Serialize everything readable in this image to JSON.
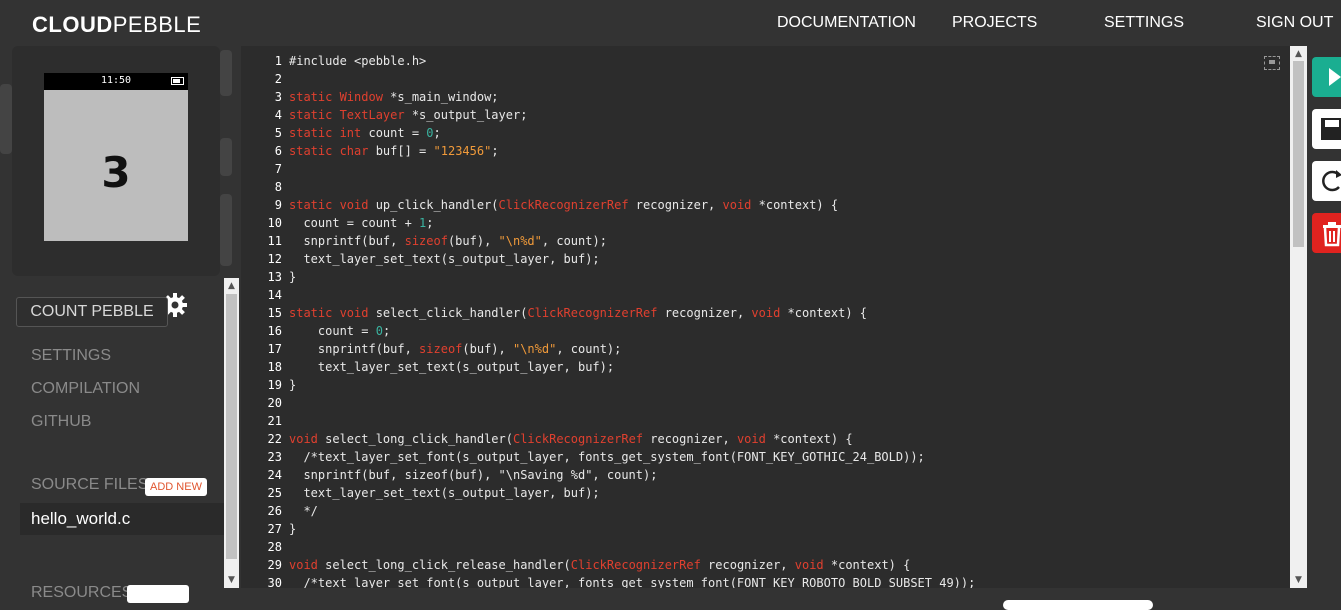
{
  "brand": {
    "bold": "CLOUD",
    "light": "PEBBLE"
  },
  "nav": [
    "DOCUMENTATION",
    "PROJECTS",
    "SETTINGS",
    "SIGN OUT"
  ],
  "emulator": {
    "time": "11:50",
    "count": "3"
  },
  "sidebar": {
    "project_name": "COUNT PEBBLE",
    "links": [
      "SETTINGS",
      "COMPILATION",
      "GITHUB"
    ],
    "source_files_label": "SOURCE FILES",
    "add_new": "ADD NEW",
    "files": [
      "hello_world.c"
    ],
    "resources_label": "RESOURCES"
  },
  "editor": {
    "lines": [
      [
        {
          "t": "#include <pebble.h>"
        }
      ],
      [],
      [
        {
          "t": "static Window",
          "c": "kw"
        },
        {
          "t": " *s_main_window;"
        }
      ],
      [
        {
          "t": "static TextLayer",
          "c": "kw"
        },
        {
          "t": " *s_output_layer;"
        }
      ],
      [
        {
          "t": "static int",
          "c": "kw"
        },
        {
          "t": " count = "
        },
        {
          "t": "0",
          "c": "num"
        },
        {
          "t": ";"
        }
      ],
      [
        {
          "t": "static char",
          "c": "kw"
        },
        {
          "t": " buf[] = "
        },
        {
          "t": "\"123456\"",
          "c": "str"
        },
        {
          "t": ";"
        }
      ],
      [],
      [],
      [
        {
          "t": "static void",
          "c": "kw"
        },
        {
          "t": " up_click_handler("
        },
        {
          "t": "ClickRecognizerRef",
          "c": "kw"
        },
        {
          "t": " recognizer, "
        },
        {
          "t": "void",
          "c": "kw"
        },
        {
          "t": " *context) {"
        }
      ],
      [
        {
          "t": "  count = count + "
        },
        {
          "t": "1",
          "c": "num"
        },
        {
          "t": ";"
        }
      ],
      [
        {
          "t": "  snprintf(buf, "
        },
        {
          "t": "sizeof",
          "c": "kw"
        },
        {
          "t": "(buf), "
        },
        {
          "t": "\"\\n%d\"",
          "c": "str"
        },
        {
          "t": ", count);"
        }
      ],
      [
        {
          "t": "  text_layer_set_text(s_output_layer, buf);"
        }
      ],
      [
        {
          "t": "}"
        }
      ],
      [],
      [
        {
          "t": "static void",
          "c": "kw"
        },
        {
          "t": " select_click_handler("
        },
        {
          "t": "ClickRecognizerRef",
          "c": "kw"
        },
        {
          "t": " recognizer, "
        },
        {
          "t": "void",
          "c": "kw"
        },
        {
          "t": " *context) {"
        }
      ],
      [
        {
          "t": "    count = "
        },
        {
          "t": "0",
          "c": "num"
        },
        {
          "t": ";"
        }
      ],
      [
        {
          "t": "    snprintf(buf, "
        },
        {
          "t": "sizeof",
          "c": "kw"
        },
        {
          "t": "(buf), "
        },
        {
          "t": "\"\\n%d\"",
          "c": "str"
        },
        {
          "t": ", count);"
        }
      ],
      [
        {
          "t": "    text_layer_set_text(s_output_layer, buf);"
        }
      ],
      [
        {
          "t": "}"
        }
      ],
      [],
      [],
      [
        {
          "t": "void",
          "c": "kw"
        },
        {
          "t": " select_long_click_handler("
        },
        {
          "t": "ClickRecognizerRef",
          "c": "kw"
        },
        {
          "t": " recognizer, "
        },
        {
          "t": "void",
          "c": "kw"
        },
        {
          "t": " *context) {"
        }
      ],
      [
        {
          "t": "  /*text_layer_set_font(s_output_layer, fonts_get_system_font(FONT_KEY_GOTHIC_24_BOLD));"
        }
      ],
      [
        {
          "t": "  snprintf(buf, sizeof(buf), \"\\nSaving %d\", count);"
        }
      ],
      [
        {
          "t": "  text_layer_set_text(s_output_layer, buf);"
        }
      ],
      [
        {
          "t": "  */"
        }
      ],
      [
        {
          "t": "}"
        }
      ],
      [],
      [
        {
          "t": "void",
          "c": "kw"
        },
        {
          "t": " select_long_click_release_handler("
        },
        {
          "t": "ClickRecognizerRef",
          "c": "kw"
        },
        {
          "t": " recognizer, "
        },
        {
          "t": "void",
          "c": "kw"
        },
        {
          "t": " *context) {"
        }
      ],
      [
        {
          "t": "  /*text_layer_set_font(s_output_layer, fonts_get_system_font(FONT_KEY_ROBOTO_BOLD_SUBSET_49));"
        }
      ]
    ]
  },
  "actions": [
    {
      "name": "run-button",
      "icon": "play-icon",
      "color": "#1aae91"
    },
    {
      "name": "save-button",
      "icon": "save-icon",
      "color": "#ffffff"
    },
    {
      "name": "reload-button",
      "icon": "refresh-icon",
      "color": "#ffffff"
    },
    {
      "name": "delete-button",
      "icon": "trash-icon",
      "color": "#e0231f"
    }
  ]
}
